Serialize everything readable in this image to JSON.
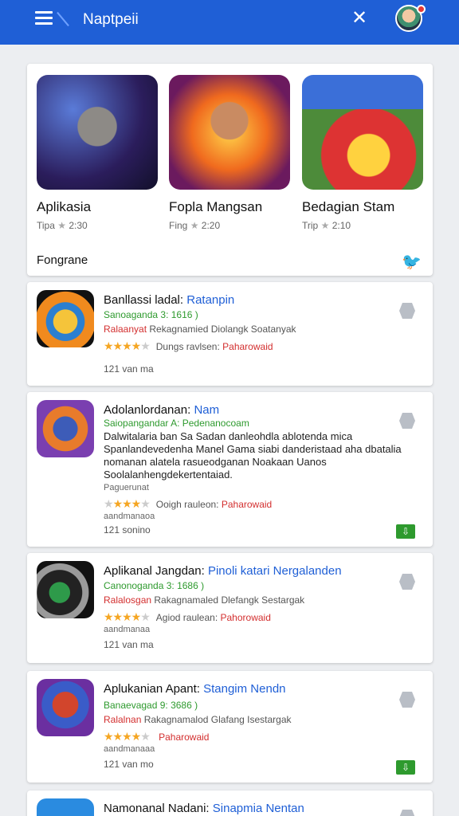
{
  "header": {
    "title": "Naptpeii",
    "avatar_badge_color": "#e53935"
  },
  "featured": [
    {
      "title": "Aplikasia",
      "meta_prefix": "Tipa",
      "meta_value": "2:30"
    },
    {
      "title": "Fopla Mangsan",
      "meta_prefix": "Fing",
      "meta_value": "2:20"
    },
    {
      "title": "Bedagian Stam",
      "meta_prefix": "Trip",
      "meta_value": "2:10"
    }
  ],
  "section": {
    "label": "Fongrane"
  },
  "apps": [
    {
      "name": "Banllassi ladal:",
      "name_accent": "Ratanpin",
      "green": "Sanoaganda 3: 1616 )",
      "red_label": "Ralaanyat",
      "red_rest": "Rekagnamied Diolangk Soatanyak",
      "rating_stars": 4,
      "rating_label": "Dungs ravlsen:",
      "rating_value": "Paharowaid",
      "count": "121 van ma"
    },
    {
      "name": "Adolanlordanan:",
      "name_accent": "Nam",
      "green": "Saiopangandar A: Pedenanocoam",
      "description": "Dalwitalaria ban Sa Sadan danleohdla ablotenda mica Spanlandevedenha Manel Gama siabi danderistaad aha dbatalia nomanan alatela rasueodganan Noakaan Uanos Soolalanhengdekertentaiad.",
      "note": "Paguerunat",
      "rating_stars": 3,
      "rating_label": "Ooigh rauleon:",
      "rating_value": "Paharowaid",
      "small": "aandmanaoa",
      "count": "121 sonino"
    },
    {
      "name": "Aplikanal Jangdan:",
      "name_accent": "Pinoli katari Nergalanden",
      "green": "Canonoganda 3: 1686 )",
      "red_label": "Ralalosgan",
      "red_rest": "Rakagnamaled Dlefangk Sestargak",
      "rating_stars": 4,
      "rating_label": "Agiod raulean:",
      "rating_value": "Pahorowaid",
      "small": "aandmanaa",
      "count": "121 van ma"
    },
    {
      "name": "Aplukanian Apant:",
      "name_accent": "Stangim Nendn",
      "green": "Banaevagad 9: 3686 )",
      "red_label": "Ralalnan",
      "red_rest": "Rakagnamalod Glafang Isestargak",
      "rating_stars": 4,
      "rating_label": "",
      "rating_value": "Paharowaid",
      "small": "aandmanaaa",
      "count": "121 van mo"
    },
    {
      "name": "Namonanal Nadani:",
      "name_accent": "Sinapmia Nentan"
    }
  ],
  "colors": {
    "brand": "#1f5fd6",
    "green": "#2e9a2e",
    "red": "#d32f2f",
    "star": "#f5a623"
  }
}
